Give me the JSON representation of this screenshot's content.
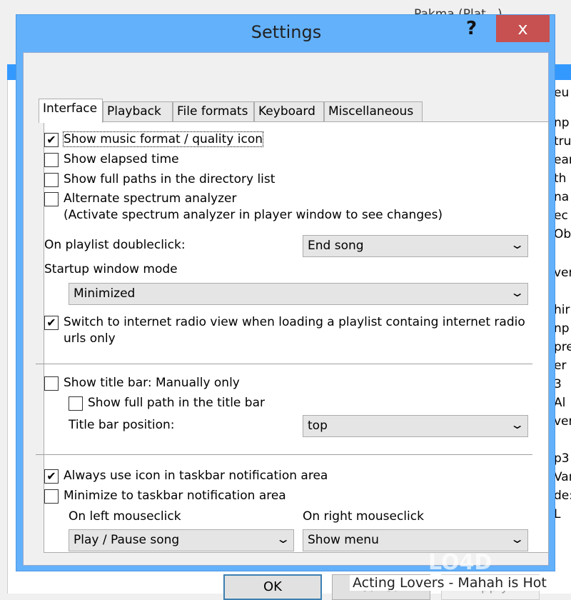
{
  "background": {
    "title": "Pakma (Plat...)",
    "fragments": [
      "eu",
      "np",
      "tru",
      "ear",
      "th",
      "na",
      "ec",
      "Ob",
      "ver",
      "hir",
      "np",
      "pre",
      "er .",
      "3",
      "Al",
      "ver",
      "p3",
      "Var",
      "de:",
      "L"
    ],
    "bottom_row": "Acting Lovers - Mahah is Hot"
  },
  "dialog": {
    "title": "Settings",
    "help": "?",
    "close": "x",
    "tabs": [
      "Interface",
      "Playback",
      "File formats",
      "Keyboard",
      "Miscellaneous"
    ],
    "active_tab": "Interface",
    "options": {
      "show_format_icon": {
        "label": "Show music format / quality icon",
        "checked": true
      },
      "show_elapsed": {
        "label": "Show elapsed time",
        "checked": false
      },
      "show_full_paths": {
        "label": "Show full paths in the directory list",
        "checked": false
      },
      "alt_spectrum": {
        "label": "Alternate spectrum analyzer",
        "checked": false,
        "note": "(Activate spectrum analyzer in player window to see changes)"
      },
      "doubleclick": {
        "label": "On playlist doubleclick:",
        "value": "End song"
      },
      "startup_mode": {
        "label": "Startup window mode",
        "value": "Minimized"
      },
      "radio_view": {
        "label": "Switch to internet radio view when loading a playlist containg internet radio",
        "label2": "urls only",
        "checked": true
      },
      "title_bar": {
        "label": "Show title bar: Manually only",
        "checked": false
      },
      "full_path_title": {
        "label": "Show full path in the title bar",
        "checked": false
      },
      "title_pos": {
        "label": "Title bar position:",
        "value": "top"
      },
      "taskbar_icon": {
        "label": "Always use icon in taskbar notification area",
        "checked": true
      },
      "minimize_taskbar": {
        "label": "Minimize to taskbar notification area",
        "checked": false
      },
      "left_click": {
        "label": "On left mouseclick",
        "value": "Play / Pause song"
      },
      "right_click": {
        "label": "On right mouseclick",
        "value": "Show menu"
      }
    },
    "buttons": {
      "ok": "OK",
      "cancel": "Cancel",
      "apply": "Apply"
    }
  },
  "watermark": "LO4D.com"
}
